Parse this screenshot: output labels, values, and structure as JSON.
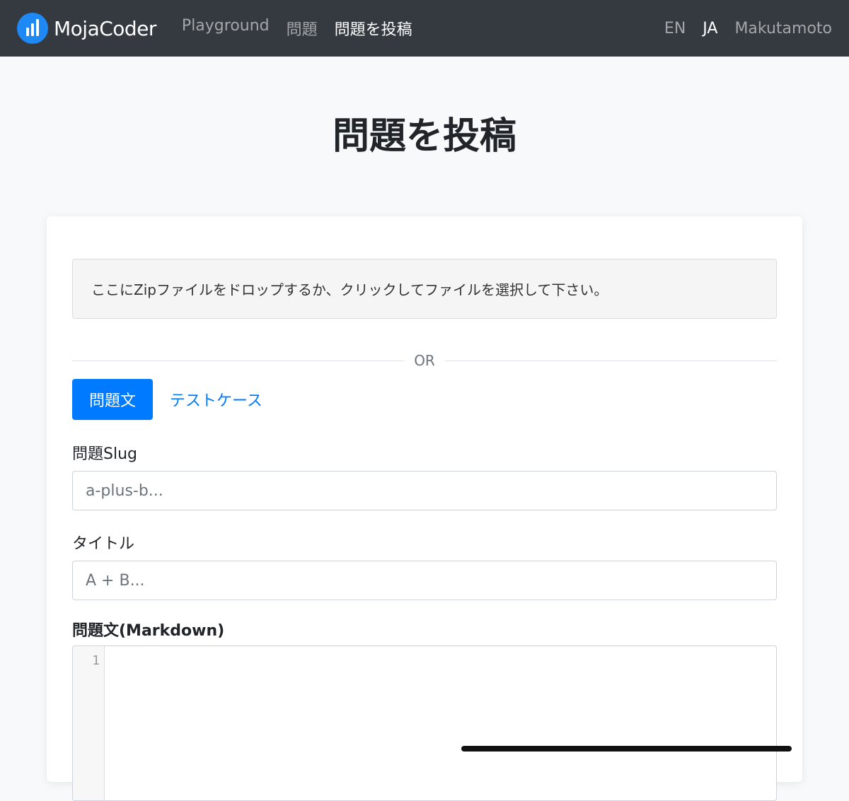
{
  "navbar": {
    "brand": "MojaCoder",
    "links": [
      "Playground",
      "問題",
      "問題を投稿"
    ],
    "lang_en": "EN",
    "lang_ja": "JA",
    "user": "Makutamoto"
  },
  "page": {
    "title": "問題を投稿"
  },
  "form": {
    "dropzone_text": "ここにZipファイルをドロップするか、クリックしてファイルを選択して下さい。",
    "or_text": "OR",
    "tabs": [
      "問題文",
      "テストケース"
    ],
    "slug_label": "問題Slug",
    "slug_placeholder": "a-plus-b...",
    "title_label": "タイトル",
    "title_placeholder": "A + B...",
    "statement_label": "問題文(Markdown)",
    "editor_line_number": "1"
  },
  "colors": {
    "navbar_bg": "#343a40",
    "primary": "#007bff",
    "logo_bg": "#1e88f5"
  }
}
